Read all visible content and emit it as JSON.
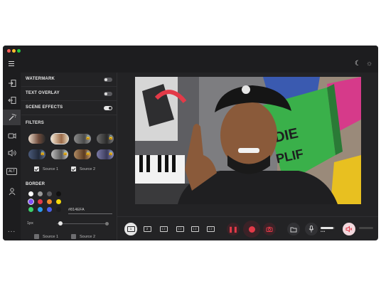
{
  "window": {
    "traffic_lights": [
      "#fe5f57",
      "#febc2e",
      "#28c840"
    ]
  },
  "topbar": {
    "menu_icon": "hamburger-icon",
    "theme_icons": [
      "moon-icon",
      "sun-icon"
    ]
  },
  "rail": {
    "items": [
      {
        "icon": "import-icon",
        "active": false
      },
      {
        "icon": "export-icon",
        "active": false
      },
      {
        "icon": "magic-wand-icon",
        "active": true
      },
      {
        "icon": "video-camera-icon",
        "active": false
      },
      {
        "icon": "speaker-icon",
        "active": false
      },
      {
        "icon": "alt-icon",
        "label": "ALT",
        "active": false
      },
      {
        "icon": "user-icon",
        "active": false
      },
      {
        "icon": "more-icon",
        "label": "...",
        "active": false
      }
    ]
  },
  "panel": {
    "toggles": [
      {
        "label": "WATERMARK",
        "on": false
      },
      {
        "label": "TEXT OVERLAY",
        "on": false
      },
      {
        "label": "SCENE EFFECTS",
        "on": true
      }
    ],
    "filters_title": "FILTERS",
    "filters": [
      {
        "style": "color",
        "locked": false,
        "selected": false
      },
      {
        "style": "warm",
        "locked": false,
        "selected": true
      },
      {
        "style": "gray",
        "locked": true,
        "selected": false
      },
      {
        "style": "gray-dark",
        "locked": true,
        "selected": false
      },
      {
        "style": "dark-blue",
        "locked": true,
        "selected": false
      },
      {
        "style": "mono",
        "locked": true,
        "selected": false
      },
      {
        "style": "sepia",
        "locked": true,
        "selected": false
      },
      {
        "style": "cool",
        "locked": true,
        "selected": false
      }
    ],
    "filter_sources": [
      {
        "label": "Source 1",
        "checked": true
      },
      {
        "label": "Source 2",
        "checked": true
      }
    ],
    "border_title": "BORDER",
    "swatch_colors": [
      "#ffffff",
      "#9a9a9a",
      "#5a5a5e",
      "#111111",
      "#814EFA",
      "#e33a48",
      "#f08a2a",
      "#f5d90a",
      "#3ccf6a",
      "#2b9cf0",
      "#4a5fe8",
      "#1d1d1f"
    ],
    "selected_swatch": 4,
    "hex_value": "#814EFA",
    "thickness_label": "1px",
    "border_sources": [
      {
        "label": "Source 1",
        "checked": false
      },
      {
        "label": "Source 2",
        "checked": false
      }
    ]
  },
  "controls": {
    "layouts": [
      {
        "label": "1",
        "active": true
      },
      {
        "label": "2",
        "active": false
      },
      {
        "label": "1 2",
        "active": false
      },
      {
        "label": "1 2",
        "active": false
      },
      {
        "label": "1 2",
        "active": false
      },
      {
        "label": "1 2",
        "active": false
      }
    ],
    "buttons": [
      "pause-icon",
      "record-icon",
      "camera-icon",
      "folder-icon",
      "microphone-icon",
      "speaker-mute-icon"
    ],
    "mic_level": 0.9,
    "speaker_level": 0.0,
    "accent": "#e33a48"
  }
}
